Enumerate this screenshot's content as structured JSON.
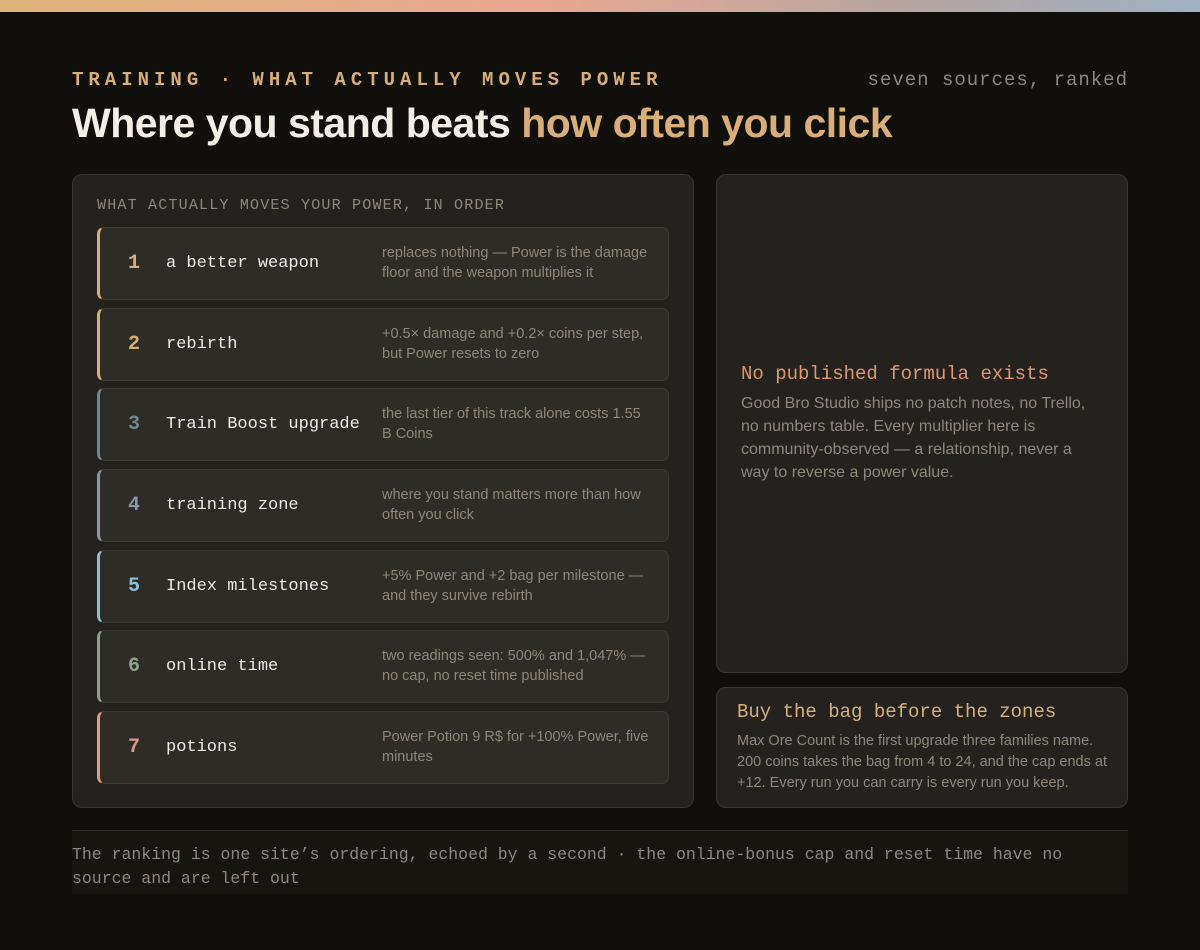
{
  "header": {
    "eyebrow": "TRAINING · WHAT ACTUALLY MOVES POWER",
    "corner_note": "seven sources, ranked",
    "headline_main": "Where you stand beats ",
    "headline_accent": "how often you click"
  },
  "ranking": {
    "title": "WHAT ACTUALLY MOVES YOUR POWER, IN ORDER",
    "items": [
      {
        "rank": "1",
        "name": "a better weapon",
        "desc": "replaces nothing — Power is the damage floor and the weapon multiplies it",
        "color": "#d7ad79"
      },
      {
        "rank": "2",
        "name": "rebirth",
        "desc": "+0.5× damage and +0.2× coins per step, but Power resets to zero",
        "color": "#d7ad79"
      },
      {
        "rank": "3",
        "name": "Train Boost upgrade",
        "desc": "the last tier of this track alone costs 1.55 B Coins",
        "color": "#6f8896"
      },
      {
        "rank": "4",
        "name": "training zone",
        "desc": "where you stand matters more than how often you click",
        "color": "#8797a6"
      },
      {
        "rank": "5",
        "name": "Index milestones",
        "desc": "+5% Power and +2 bag per milestone — and they survive rebirth",
        "color": "#92bdd6"
      },
      {
        "rank": "6",
        "name": "online time",
        "desc": "two readings seen: 500% and 1,047% — no cap, no reset time published",
        "color": "#8fa287"
      },
      {
        "rank": "7",
        "name": "potions",
        "desc": "Power Potion 9 R$ for +100% Power, five minutes",
        "color": "#e19b84"
      }
    ]
  },
  "note": {
    "title": "No published formula exists",
    "body": "Good Bro Studio ships no patch notes, no Trello, no numbers table. Every multiplier here is community-observed — a relationship, never a way to reverse a power value."
  },
  "tip": {
    "title": "Buy the bag before the zones",
    "body": "Max Ore Count is the first upgrade three families name. 200 coins takes the bag from 4 to 24, and the cap ends at +12. Every run you can carry is every run you keep."
  },
  "footer": {
    "text": "The ranking is one site’s ordering, echoed by a second · the online-bonus cap and reset time have no source and are left out"
  }
}
